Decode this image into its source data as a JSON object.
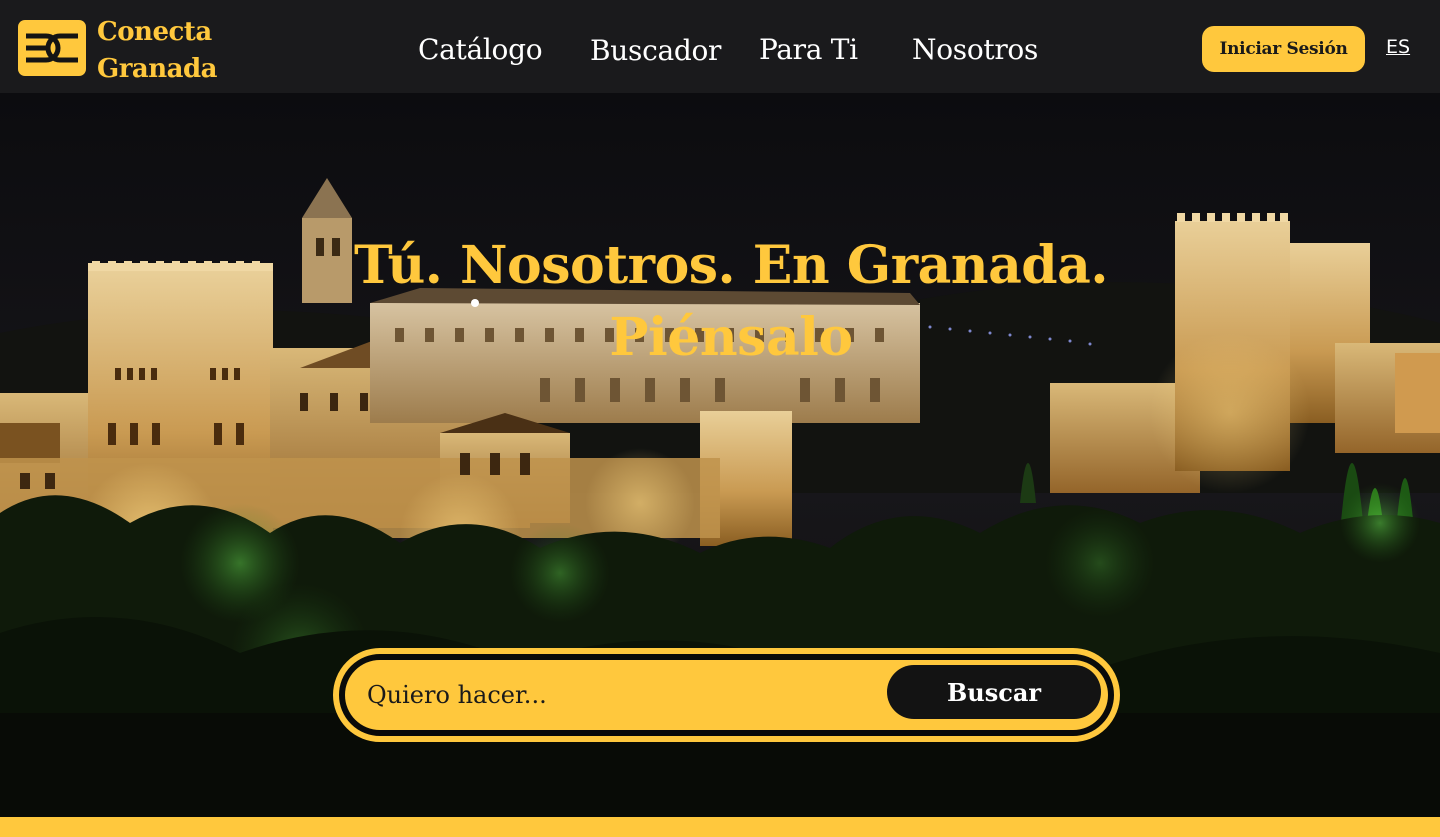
{
  "brand": {
    "name_line1": "Conecta",
    "name_line2": "Granada",
    "logo_icon": "cg-logo-icon",
    "accent_color": "#ffc83d"
  },
  "nav": {
    "items": [
      {
        "label": "Catálogo"
      },
      {
        "label": "Buscador"
      },
      {
        "label": "Para Ti"
      },
      {
        "label": "Nosotros"
      }
    ],
    "login_label": "Iniciar Sesión",
    "language": "ES"
  },
  "hero": {
    "title_line1": "Tú. Nosotros. En Granada.",
    "title_line2": "Piénsalo"
  },
  "search": {
    "placeholder": "Quiero hacer...",
    "value": "",
    "button_label": "Buscar"
  },
  "colors": {
    "header_bg": "#1a1a1c",
    "accent": "#ffc83d",
    "dark": "#131313"
  }
}
